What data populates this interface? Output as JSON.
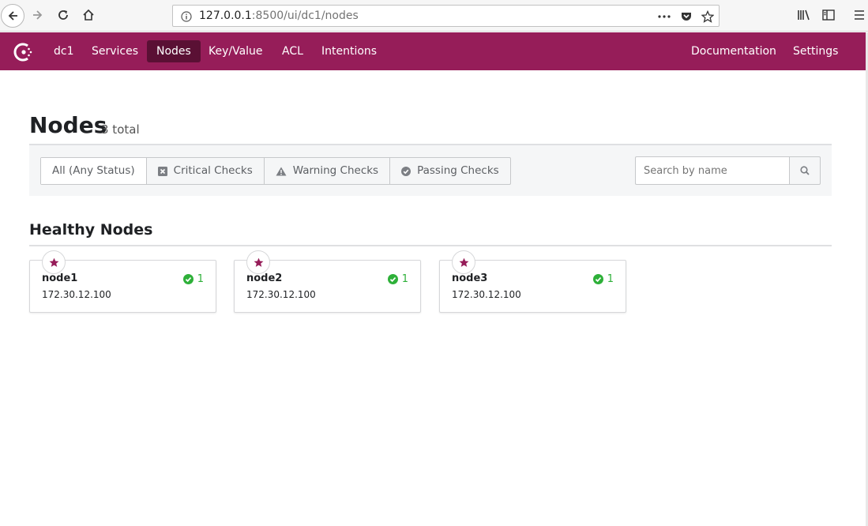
{
  "browser": {
    "url_host": "127.0.0.1",
    "url_rest": ":8500/ui/dc1/nodes"
  },
  "header": {
    "datacenter": "dc1",
    "nav": [
      {
        "label": "Services"
      },
      {
        "label": "Nodes",
        "active": true
      },
      {
        "label": "Key/Value"
      },
      {
        "label": "ACL"
      },
      {
        "label": "Intentions"
      }
    ],
    "documentation": "Documentation",
    "settings": "Settings",
    "brand_color": "#961d59"
  },
  "page": {
    "title": "Nodes",
    "count": "3 total"
  },
  "filters": {
    "options": [
      {
        "label": "All (Any Status)",
        "icon": ""
      },
      {
        "label": "Critical Checks",
        "icon": "critical-icon"
      },
      {
        "label": "Warning Checks",
        "icon": "warning-icon"
      },
      {
        "label": "Passing Checks",
        "icon": "passing-icon"
      }
    ],
    "search_placeholder": "Search by name"
  },
  "section": {
    "title": "Healthy Nodes"
  },
  "nodes": [
    {
      "name": "node1",
      "address": "172.30.12.100",
      "passing": "1"
    },
    {
      "name": "node2",
      "address": "172.30.12.100",
      "passing": "1"
    },
    {
      "name": "node3",
      "address": "172.30.12.100",
      "passing": "1"
    }
  ]
}
